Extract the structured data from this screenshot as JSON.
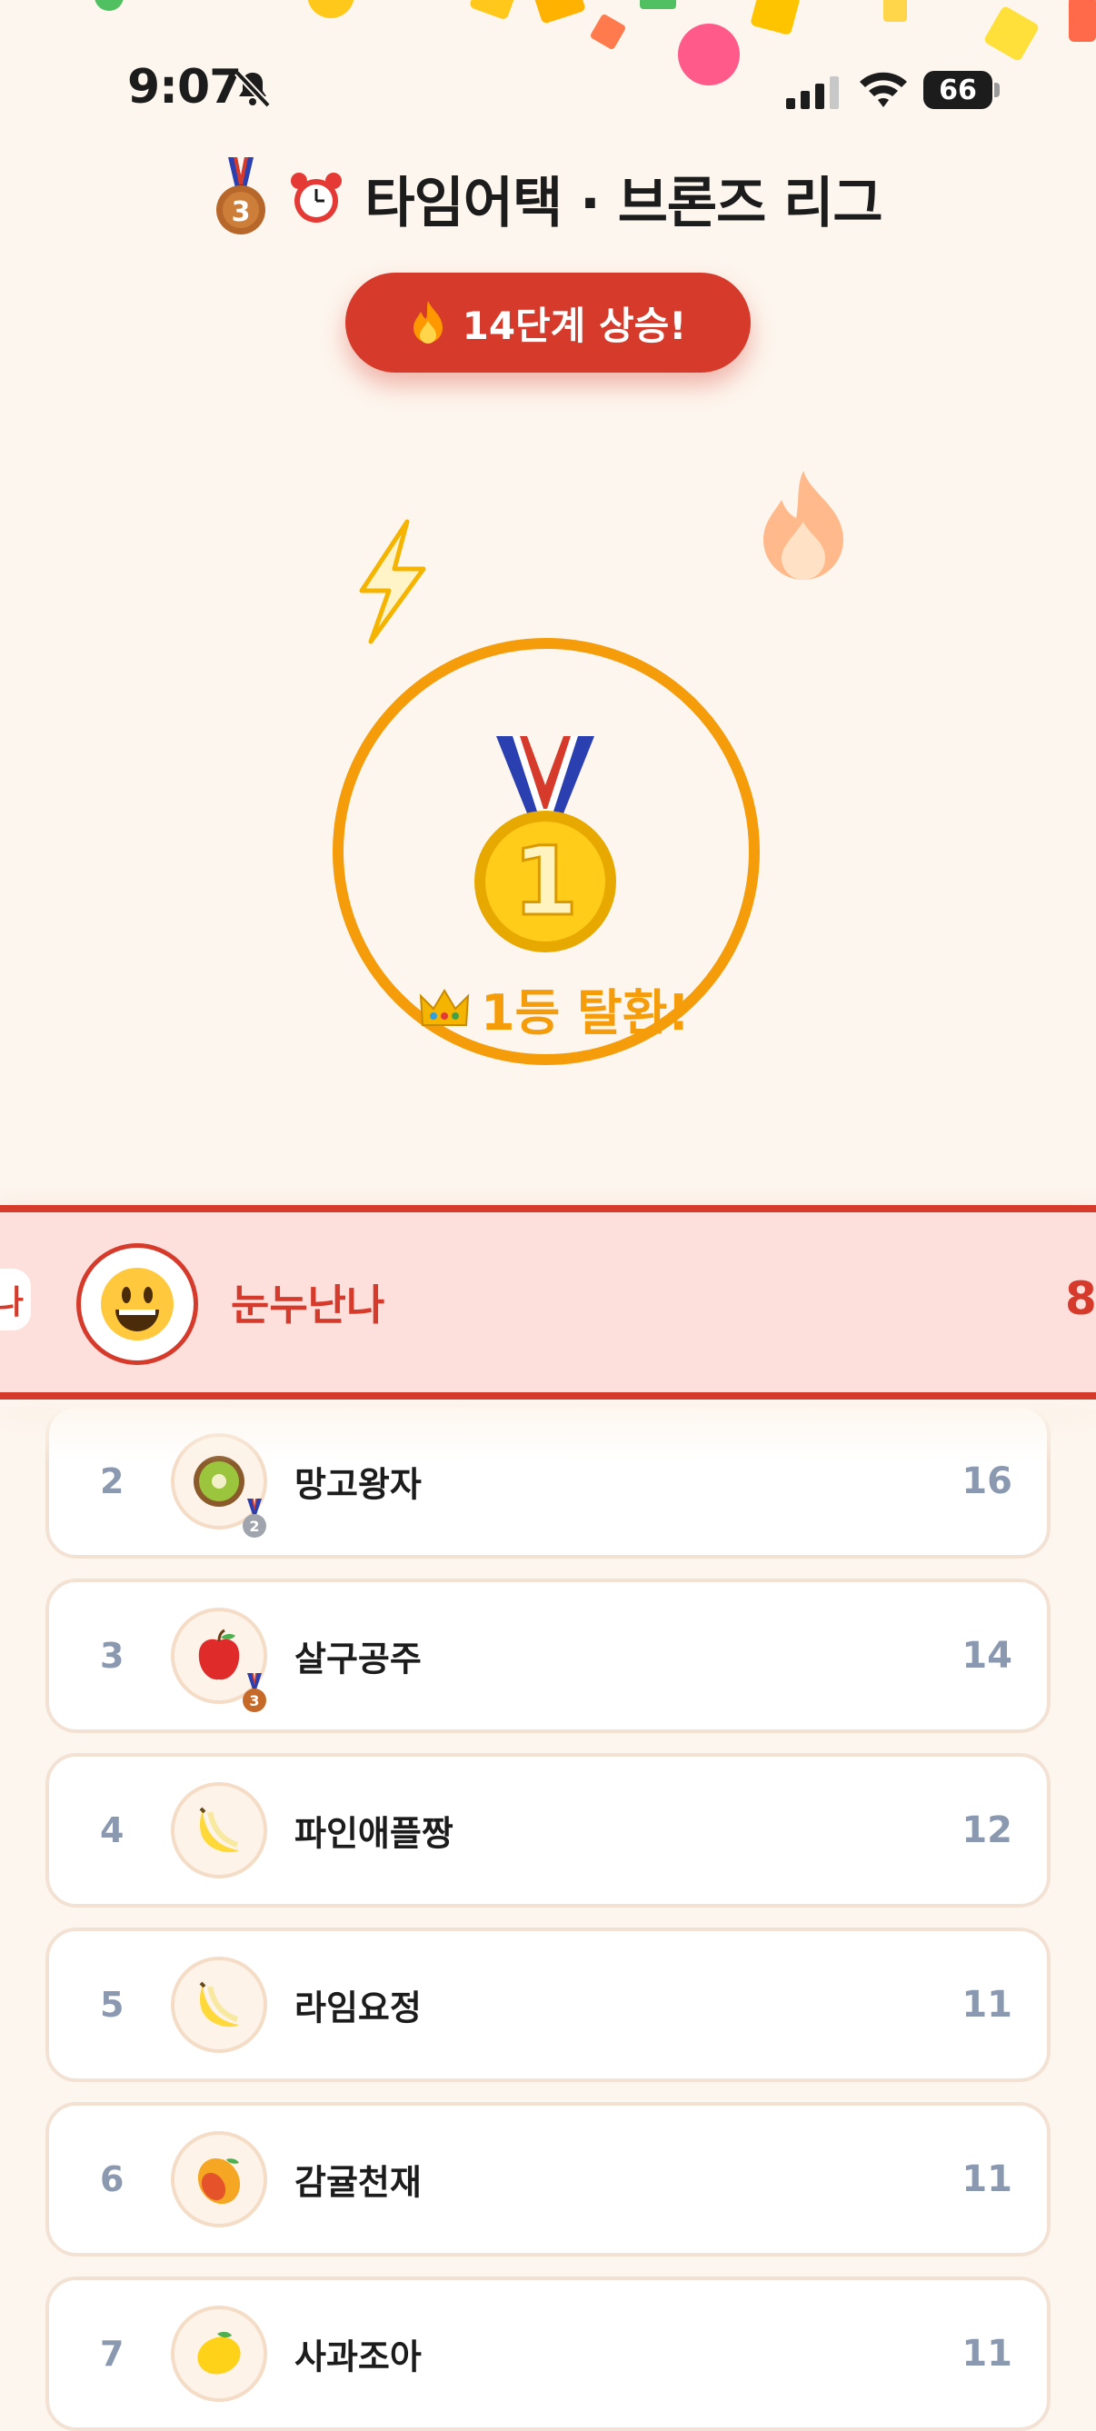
{
  "status_bar": {
    "time": "9:07",
    "battery": "66"
  },
  "header": {
    "title": "타임어택 · 브론즈 리그"
  },
  "rise_pill": {
    "label": "14단계 상승!"
  },
  "result": {
    "rank_text": "1등 탈환!",
    "medal_number": "1"
  },
  "highlight": {
    "left_fragment": "나",
    "name": "눈누난나",
    "score": "8"
  },
  "leaderboard": [
    {
      "rank": "2",
      "name": "망고왕자",
      "score": "16",
      "avatar": "kiwi",
      "badge": "2"
    },
    {
      "rank": "3",
      "name": "살구공주",
      "score": "14",
      "avatar": "apple",
      "badge": "3"
    },
    {
      "rank": "4",
      "name": "파인애플짱",
      "score": "12",
      "avatar": "banana",
      "badge": ""
    },
    {
      "rank": "5",
      "name": "라임요정",
      "score": "11",
      "avatar": "banana",
      "badge": ""
    },
    {
      "rank": "6",
      "name": "감귤천재",
      "score": "11",
      "avatar": "mango",
      "badge": ""
    },
    {
      "rank": "7",
      "name": "사과조아",
      "score": "11",
      "avatar": "lemon",
      "badge": ""
    }
  ],
  "colors": {
    "accent": "#d63a2a",
    "gold": "#f59c0b",
    "background": "#fdf6ee",
    "muted": "#8a99b0"
  }
}
